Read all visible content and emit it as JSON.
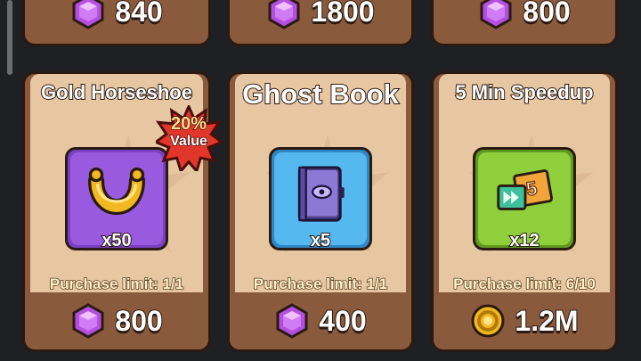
{
  "top_row": [
    {
      "currency_icon": "gem-icon",
      "price": "840"
    },
    {
      "currency_icon": "gem-icon",
      "price": "1800"
    },
    {
      "currency_icon": "gem-icon",
      "price": "800"
    }
  ],
  "offers": [
    {
      "title": "Gold Horseshoe",
      "item_icon": "horseshoe-icon",
      "quantity": "x50",
      "limit": "Purchase limit: 1/1",
      "currency_icon": "gem-icon",
      "price": "800",
      "badge": {
        "percent": "20%",
        "label": "Value"
      },
      "tile_color": "#8e4fd6"
    },
    {
      "title": "Ghost Book",
      "item_icon": "book-icon",
      "quantity": "x5",
      "limit": "Purchase limit: 1/1",
      "currency_icon": "gem-icon",
      "price": "400",
      "tile_color": "#3fa6de"
    },
    {
      "title": "5 Min Speedup",
      "item_icon": "speedup-ticket-icon",
      "quantity": "x12",
      "limit": "Purchase limit: 6/10",
      "currency_icon": "gold-coin-icon",
      "price": "1.2M",
      "tile_color": "#7dbb2c"
    }
  ],
  "colors": {
    "card_frame": "#8a5a3c",
    "card_body": "#e7c7a2",
    "gem": "#b44fe0",
    "coin": "#f2b820",
    "badge": "#e2362a"
  }
}
